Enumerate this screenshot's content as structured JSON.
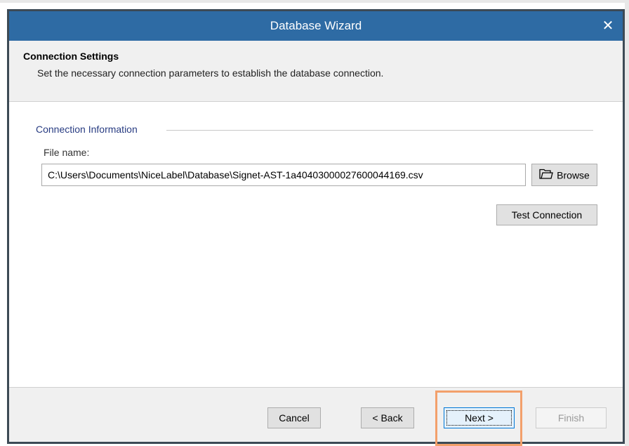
{
  "window": {
    "title": "Database Wizard",
    "close_glyph": "✕"
  },
  "header": {
    "title": "Connection Settings",
    "subtitle": "Set the necessary connection parameters to establish the database connection."
  },
  "content": {
    "group_label": "Connection Information",
    "file_label": "File name:",
    "file_value": "C:\\Users\\Documents\\NiceLabel\\Database\\Signet-AST-1a40403000027600044169.csv",
    "browse_label": "Browse",
    "browse_icon": "folder-icon",
    "test_connection_label": "Test Connection"
  },
  "footer": {
    "cancel_label": "Cancel",
    "back_label": "< Back",
    "next_label": "Next >",
    "finish_label": "Finish"
  },
  "colors": {
    "titlebar": "#2e6ba4",
    "highlight": "#f3a06b",
    "group_label": "#283c82"
  }
}
